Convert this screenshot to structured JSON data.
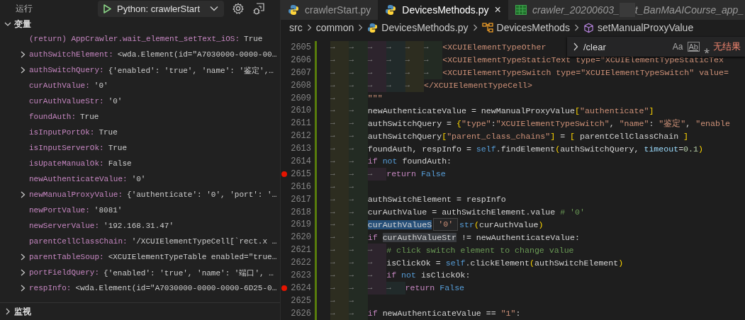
{
  "run_panel": {
    "title": "运行",
    "config": "Python: crawlerStart"
  },
  "sections": [
    {
      "title": "变量",
      "expanded": true
    },
    {
      "title": "监视",
      "expanded": false
    }
  ],
  "variables": [
    {
      "kind": "bool",
      "name": "(return) AppCrawler.wait_element_setText_iOS:",
      "value": "True"
    },
    {
      "kind": "object",
      "expanded": false,
      "name": "authSwitchElement:",
      "value": "<wda.Element(id=\"A7030000-0000-00…"
    },
    {
      "kind": "object",
      "expanded": false,
      "name": "authSwitchQuery:",
      "value": "{'enabled': 'true', 'name': '鉴定',…"
    },
    {
      "kind": "string",
      "name": "curAuthValue:",
      "value": "'0'"
    },
    {
      "kind": "string",
      "name": "curAuthValueStr:",
      "value": "'0'"
    },
    {
      "kind": "bool",
      "name": "foundAuth:",
      "value": "True"
    },
    {
      "kind": "bool",
      "name": "isInputPortOk:",
      "value": "True"
    },
    {
      "kind": "bool",
      "name": "isInputServerOk:",
      "value": "True"
    },
    {
      "kind": "bool",
      "name": "isUpateManualOk:",
      "value": "False"
    },
    {
      "kind": "string",
      "name": "newAuthenticateValue:",
      "value": "'0'"
    },
    {
      "kind": "object",
      "expanded": false,
      "name": "newManualProxyValue:",
      "value": "{'authenticate': '0', 'port': '…"
    },
    {
      "kind": "string",
      "name": "newPortValue:",
      "value": "'8081'"
    },
    {
      "kind": "string",
      "name": "newServerValue:",
      "value": "'192.168.31.47'"
    },
    {
      "kind": "string",
      "name": "parentCellClassChain:",
      "value": "'/XCUIElementTypeCell[`rect.x …"
    },
    {
      "kind": "object",
      "expanded": false,
      "name": "parentTableSoup:",
      "value": "<XCUIElementTypeTable enabled=\"true…"
    },
    {
      "kind": "object",
      "expanded": false,
      "name": "portFieldQuery:",
      "value": "{'enabled': 'true', 'name': '端口', …"
    },
    {
      "kind": "object",
      "expanded": false,
      "name": "respInfo:",
      "value": "<wda.Element(id=\"A7030000-0000-0000-6D25-0…"
    }
  ],
  "tabs": [
    {
      "kind": "python",
      "label": "crawlerStart.py",
      "selected": false,
      "preview": false
    },
    {
      "kind": "python",
      "label": "DevicesMethods.py",
      "selected": true,
      "preview": false,
      "close": "×"
    },
    {
      "kind": "sheet",
      "label": "crawler_20200603_",
      "label_end": "t_BanMaAICourse_app_",
      "selected": false,
      "preview": true
    }
  ],
  "breadcrumb": [
    {
      "kind": "folder",
      "label": "src"
    },
    {
      "kind": "folder",
      "label": "common"
    },
    {
      "kind": "python",
      "label": "DevicesMethods.py"
    },
    {
      "kind": "class",
      "label": "DevicesMethods"
    },
    {
      "kind": "method",
      "label": "setManualProxyValue"
    }
  ],
  "find_widget": {
    "value": "/clear",
    "options": [
      "Aa",
      "Ab",
      "⁎"
    ],
    "result": "无结果"
  },
  "code_lines": [
    {
      "number": "2605",
      "breakpoint": false,
      "indent": [
        "→",
        "→",
        "→",
        "→",
        "→",
        "→"
      ],
      "tokens": [
        {
          "kind": "str",
          "text": "<XCUIElementTypeOther"
        }
      ]
    },
    {
      "number": "2606",
      "breakpoint": false,
      "indent": [
        "→",
        "→",
        "→",
        "→",
        "→",
        "→"
      ],
      "tokens": [
        {
          "kind": "str",
          "text": "<XCUIElementTypeStaticText type=\"XCUIElementTypeStaticTex"
        }
      ]
    },
    {
      "number": "2607",
      "breakpoint": false,
      "indent": [
        "→",
        "→",
        "→",
        "→",
        "→",
        "→"
      ],
      "tokens": [
        {
          "kind": "str",
          "text": "<XCUIElementTypeSwitch type=\"XCUIElementTypeSwitch\" value="
        }
      ]
    },
    {
      "number": "2608",
      "breakpoint": false,
      "indent": [
        "→",
        "→",
        "→",
        "→",
        "→"
      ],
      "tokens": [
        {
          "kind": "str",
          "text": "</XCUIElementTypeCell>"
        }
      ]
    },
    {
      "number": "2609",
      "breakpoint": false,
      "indent": [
        "→",
        "→"
      ],
      "tokens": [
        {
          "kind": "str",
          "text": "\"\"\""
        }
      ]
    },
    {
      "number": "2610",
      "breakpoint": false,
      "indent": [
        "→",
        "→"
      ],
      "tokens": [
        {
          "kind": "plain",
          "text": "newAuthenticateValue = newManualProxyValue"
        },
        {
          "kind": "bracket",
          "text": "["
        },
        {
          "kind": "str",
          "text": "\"authenticate\""
        },
        {
          "kind": "bracket",
          "text": "]"
        }
      ]
    },
    {
      "number": "2611",
      "breakpoint": false,
      "indent": [
        "→",
        "→"
      ],
      "tokens": [
        {
          "kind": "plain",
          "text": "authSwitchQuery = "
        },
        {
          "kind": "bracket",
          "text": "{"
        },
        {
          "kind": "str",
          "text": "\"type\""
        },
        {
          "kind": "plain",
          "text": ":"
        },
        {
          "kind": "str",
          "text": "\"XCUIElementTypeSwitch\""
        },
        {
          "kind": "plain",
          "text": ", "
        },
        {
          "kind": "str",
          "text": "\"name\""
        },
        {
          "kind": "plain",
          "text": ": "
        },
        {
          "kind": "str",
          "text": "\"鉴定\""
        },
        {
          "kind": "plain",
          "text": ", "
        },
        {
          "kind": "str",
          "text": "\"enable"
        }
      ]
    },
    {
      "number": "2612",
      "breakpoint": false,
      "indent": [
        "→",
        "→"
      ],
      "tokens": [
        {
          "kind": "plain",
          "text": "authSwitchQuery"
        },
        {
          "kind": "bracket",
          "text": "["
        },
        {
          "kind": "str",
          "text": "\"parent_class_chains\""
        },
        {
          "kind": "bracket",
          "text": "]"
        },
        {
          "kind": "plain",
          "text": " = "
        },
        {
          "kind": "bracket",
          "text": "["
        },
        {
          "kind": "plain",
          "text": " parentCellClassChain "
        },
        {
          "kind": "bracket",
          "text": "]"
        }
      ]
    },
    {
      "number": "2613",
      "breakpoint": false,
      "indent": [
        "→",
        "→"
      ],
      "tokens": [
        {
          "kind": "plain",
          "text": "foundAuth, respInfo = "
        },
        {
          "kind": "kw",
          "text": "self"
        },
        {
          "kind": "plain",
          "text": ".findElement"
        },
        {
          "kind": "bracket",
          "text": "("
        },
        {
          "kind": "plain",
          "text": "authSwitchQuery, "
        },
        {
          "kind": "param",
          "text": "timeout"
        },
        {
          "kind": "plain",
          "text": "="
        },
        {
          "kind": "num",
          "text": "0.1"
        },
        {
          "kind": "bracket",
          "text": ")"
        }
      ]
    },
    {
      "number": "2614",
      "breakpoint": false,
      "indent": [
        "→",
        "→"
      ],
      "tokens": [
        {
          "kind": "ctrl",
          "text": "if "
        },
        {
          "kind": "kw",
          "text": "not"
        },
        {
          "kind": "plain",
          "text": " foundAuth:"
        }
      ]
    },
    {
      "number": "2615",
      "breakpoint": true,
      "indent": [
        "→",
        "→",
        "→"
      ],
      "tokens": [
        {
          "kind": "ctrl",
          "text": "return "
        },
        {
          "kind": "kw",
          "text": "False"
        }
      ]
    },
    {
      "number": "2616",
      "breakpoint": false,
      "indent": [
        "→",
        "→"
      ]
    },
    {
      "number": "2617",
      "breakpoint": false,
      "indent": [
        "→",
        "→"
      ],
      "tokens": [
        {
          "kind": "plain",
          "text": "authSwitchElement = respInfo"
        }
      ]
    },
    {
      "number": "2618",
      "breakpoint": false,
      "indent": [
        "→",
        "→"
      ],
      "tokens": [
        {
          "kind": "plain",
          "text": "curAuthValue = authSwitchElement.value "
        },
        {
          "kind": "comment",
          "text": "# '0'"
        }
      ]
    },
    {
      "number": "2619",
      "breakpoint": false,
      "indent": [
        "→",
        "→"
      ],
      "tokens": [
        {
          "kind": "sel",
          "text": "curAuthValueS"
        },
        {
          "kind": "hover",
          "text": "'0'"
        },
        {
          "kind": "kw",
          "text": "str"
        },
        {
          "kind": "bracket",
          "text": "("
        },
        {
          "kind": "plain",
          "text": "curAuthValue"
        },
        {
          "kind": "bracket",
          "text": ")"
        }
      ]
    },
    {
      "number": "2620",
      "breakpoint": false,
      "indent": [
        "→",
        "→"
      ],
      "tokens": [
        {
          "kind": "ctrl",
          "text": "if "
        },
        {
          "kind": "hl",
          "text": "curAuthValueStr"
        },
        {
          "kind": "plain",
          "text": " != newAuthenticateValue:"
        }
      ]
    },
    {
      "number": "2621",
      "breakpoint": false,
      "indent": [
        "→",
        "→",
        "→"
      ],
      "tokens": [
        {
          "kind": "comment",
          "text": "# click switch element to change value"
        }
      ]
    },
    {
      "number": "2622",
      "breakpoint": false,
      "indent": [
        "→",
        "→",
        "→"
      ],
      "tokens": [
        {
          "kind": "plain",
          "text": "isClickOk = "
        },
        {
          "kind": "kw",
          "text": "self"
        },
        {
          "kind": "plain",
          "text": ".clickElement"
        },
        {
          "kind": "bracket",
          "text": "("
        },
        {
          "kind": "plain",
          "text": "authSwitchElement"
        },
        {
          "kind": "bracket",
          "text": ")"
        }
      ]
    },
    {
      "number": "2623",
      "breakpoint": false,
      "indent": [
        "→",
        "→",
        "→"
      ],
      "tokens": [
        {
          "kind": "ctrl",
          "text": "if "
        },
        {
          "kind": "kw",
          "text": "not"
        },
        {
          "kind": "plain",
          "text": " isClickOk:"
        }
      ]
    },
    {
      "number": "2624",
      "breakpoint": true,
      "indent": [
        "→",
        "→",
        "→",
        "→"
      ],
      "tokens": [
        {
          "kind": "ctrl",
          "text": "return "
        },
        {
          "kind": "kw",
          "text": "False"
        }
      ]
    },
    {
      "number": "2625",
      "breakpoint": false,
      "indent": [
        "→",
        "→"
      ]
    },
    {
      "number": "2626",
      "breakpoint": false,
      "indent": [
        "→",
        "→"
      ],
      "tokens": [
        {
          "kind": "ctrl",
          "text": "if"
        },
        {
          "kind": "plain",
          "text": " newAuthenticateValue == "
        },
        {
          "kind": "str",
          "text": "\"1\""
        },
        {
          "kind": "plain",
          "text": ":"
        }
      ]
    }
  ]
}
